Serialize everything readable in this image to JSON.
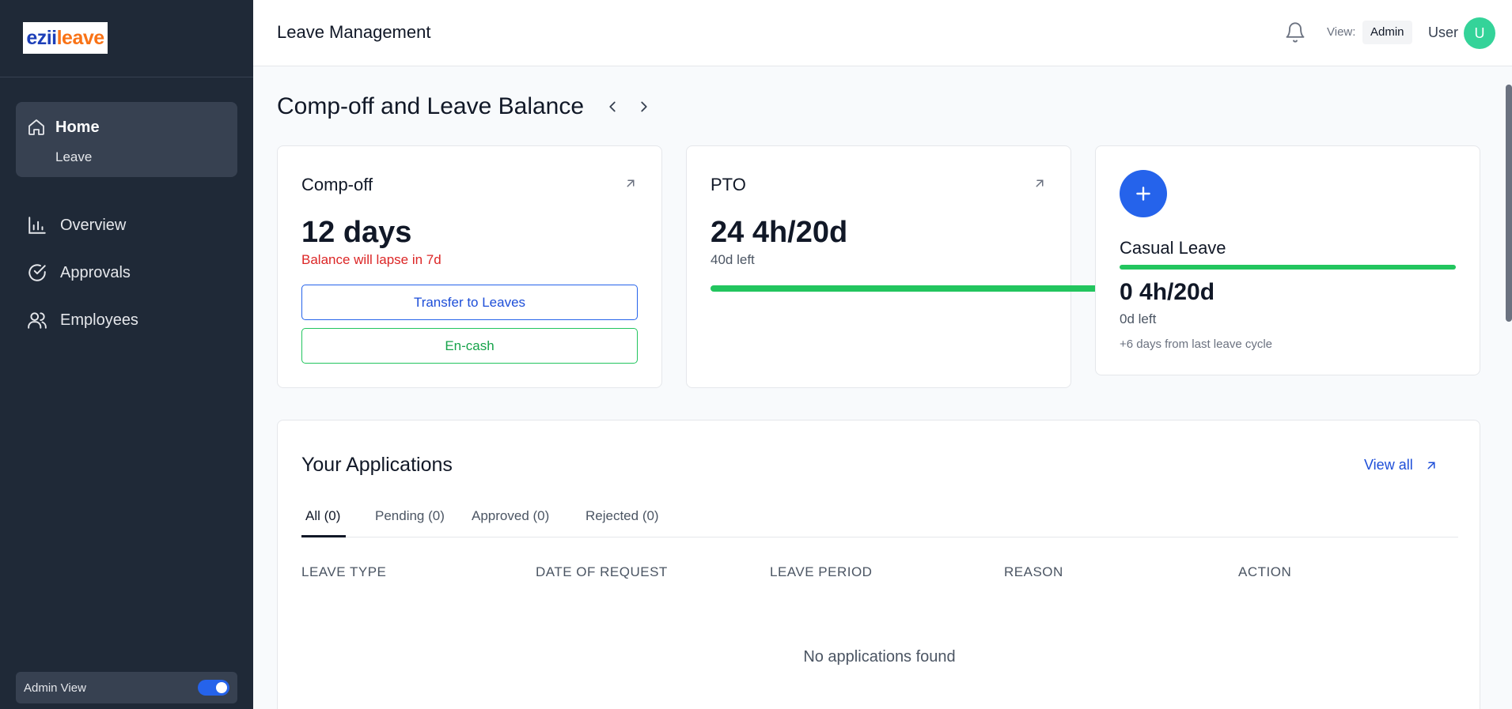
{
  "sidebar": {
    "logo": {
      "part1": "ezii",
      "part2": "leave"
    },
    "home": {
      "label": "Home",
      "sub": "Leave"
    },
    "items": [
      {
        "label": "Overview",
        "icon": "bar-chart-icon"
      },
      {
        "label": "Approvals",
        "icon": "check-circle-icon"
      },
      {
        "label": "Employees",
        "icon": "users-icon"
      }
    ],
    "admin_view": {
      "label": "Admin View",
      "enabled": true
    }
  },
  "header": {
    "title": "Leave Management",
    "view_label": "View:",
    "view_value": "Admin",
    "user_label": "User",
    "avatar_initial": "U"
  },
  "balance": {
    "title": "Comp-off and Leave Balance",
    "cards": {
      "compoff": {
        "title": "Comp-off",
        "value": "12 days",
        "warning": "Balance will lapse in 7d",
        "transfer_label": "Transfer to Leaves",
        "encash_label": "En-cash"
      },
      "pto": {
        "title": "PTO",
        "value": "24 4h/20d",
        "left": "40d left",
        "progress_fraction": 1.0
      },
      "casual": {
        "title": "Casual Leave",
        "value": "0 4h/20d",
        "left": "0d left",
        "note": "+6 days from last leave cycle",
        "progress_fraction": 1.0
      }
    }
  },
  "applications": {
    "title": "Your Applications",
    "view_all": "View all",
    "tabs": [
      "All (0)",
      "Pending (0)",
      "Approved (0)",
      "Rejected (0)"
    ],
    "active_tab": "All (0)",
    "columns": [
      "LEAVE TYPE",
      "DATE OF REQUEST",
      "LEAVE PERIOD",
      "REASON",
      "ACTION"
    ],
    "empty_message": "No applications found"
  },
  "colors": {
    "sidebar_bg": "#1f2937",
    "accent_blue": "#2563eb",
    "success_green": "#22c55e",
    "danger_red": "#dc2626",
    "avatar_bg": "#34d399"
  }
}
